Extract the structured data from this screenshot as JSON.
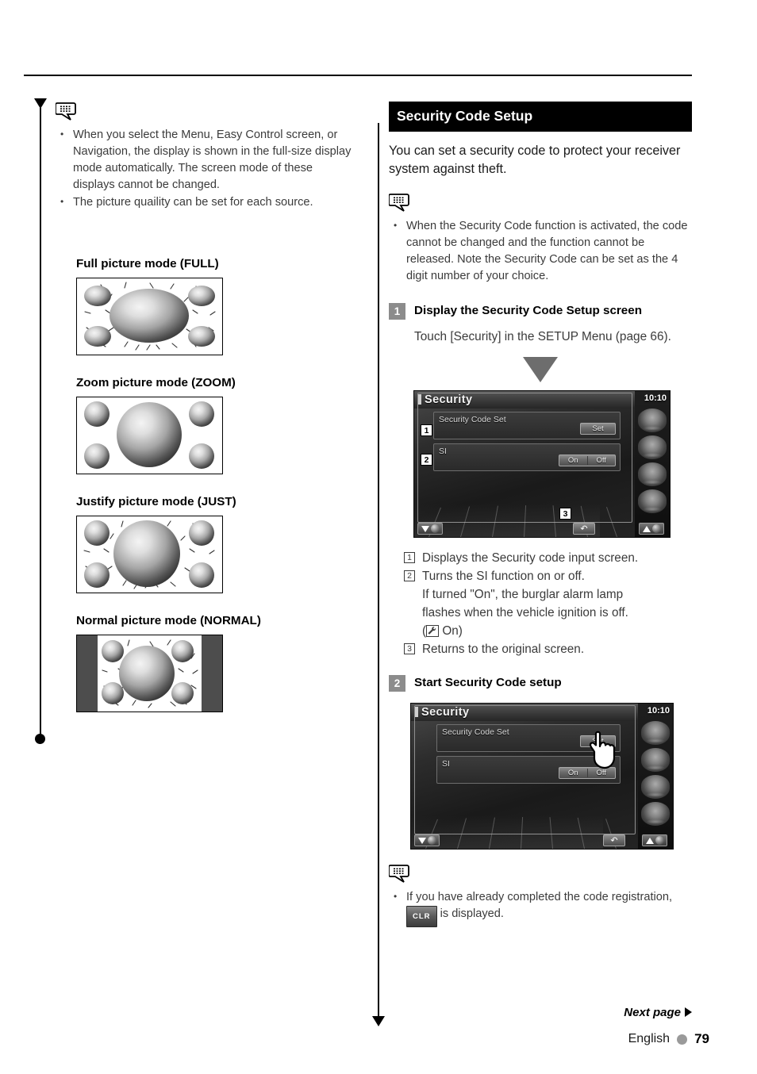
{
  "left": {
    "note_icon": "note-bubble-icon",
    "notes": [
      "When you select the Menu, Easy Control screen, or Navigation, the display is shown in the full-size display mode automatically. The screen mode of these displays cannot be changed.",
      "The picture quaility can be set for each source."
    ],
    "modes": [
      {
        "title": "Full picture mode (FULL)",
        "style": "full"
      },
      {
        "title": "Zoom picture mode (ZOOM)",
        "style": "zoom"
      },
      {
        "title": "Justify picture mode (JUST)",
        "style": "just"
      },
      {
        "title": "Normal picture mode (NORMAL)",
        "style": "normal"
      }
    ]
  },
  "right": {
    "section_title": "Security Code Setup",
    "intro": "You can set a security code to protect your receiver system against theft.",
    "note1": "When the Security Code function is activated, the code cannot be changed and the function cannot be released. Note the Security Code can be set as the 4 digit number of your choice.",
    "step1": {
      "number": "1",
      "title": "Display the Security Code Setup screen",
      "body": "Touch [Security] in the SETUP Menu (page 66)."
    },
    "step2": {
      "number": "2",
      "title": "Start Security Code setup"
    },
    "explanations": [
      {
        "num": "1",
        "text": "Displays the Security code input screen."
      },
      {
        "num": "2",
        "text": "Turns the SI function on or off."
      },
      {
        "num": "3",
        "text": "Returns to the original screen."
      }
    ],
    "explanation_sub_1": "If turned \"On\", the burglar alarm lamp",
    "explanation_sub_2": "flashes when the vehicle ignition is off.",
    "explanation_sub_3_prefix": "(",
    "explanation_sub_3_suffix": " On)",
    "note2_prefix": "If you have already completed the code registration,",
    "note2_chip": "CLR",
    "note2_suffix": "is displayed."
  },
  "device": {
    "title": "Security",
    "clock": "10:10",
    "row1_label": "Security Code Set",
    "row1_button": "Set",
    "row2_label": "SI",
    "row2_on": "On",
    "row2_off": "Off",
    "callouts": {
      "one": "1",
      "two": "2",
      "three": "3"
    },
    "return_icon": "return-arrow-icon",
    "source_icons": [
      "source-icon-1",
      "source-icon-2",
      "source-icon-3",
      "source-icon-4"
    ]
  },
  "footer": {
    "next_page": "Next page",
    "language": "English",
    "page_number": "79"
  }
}
